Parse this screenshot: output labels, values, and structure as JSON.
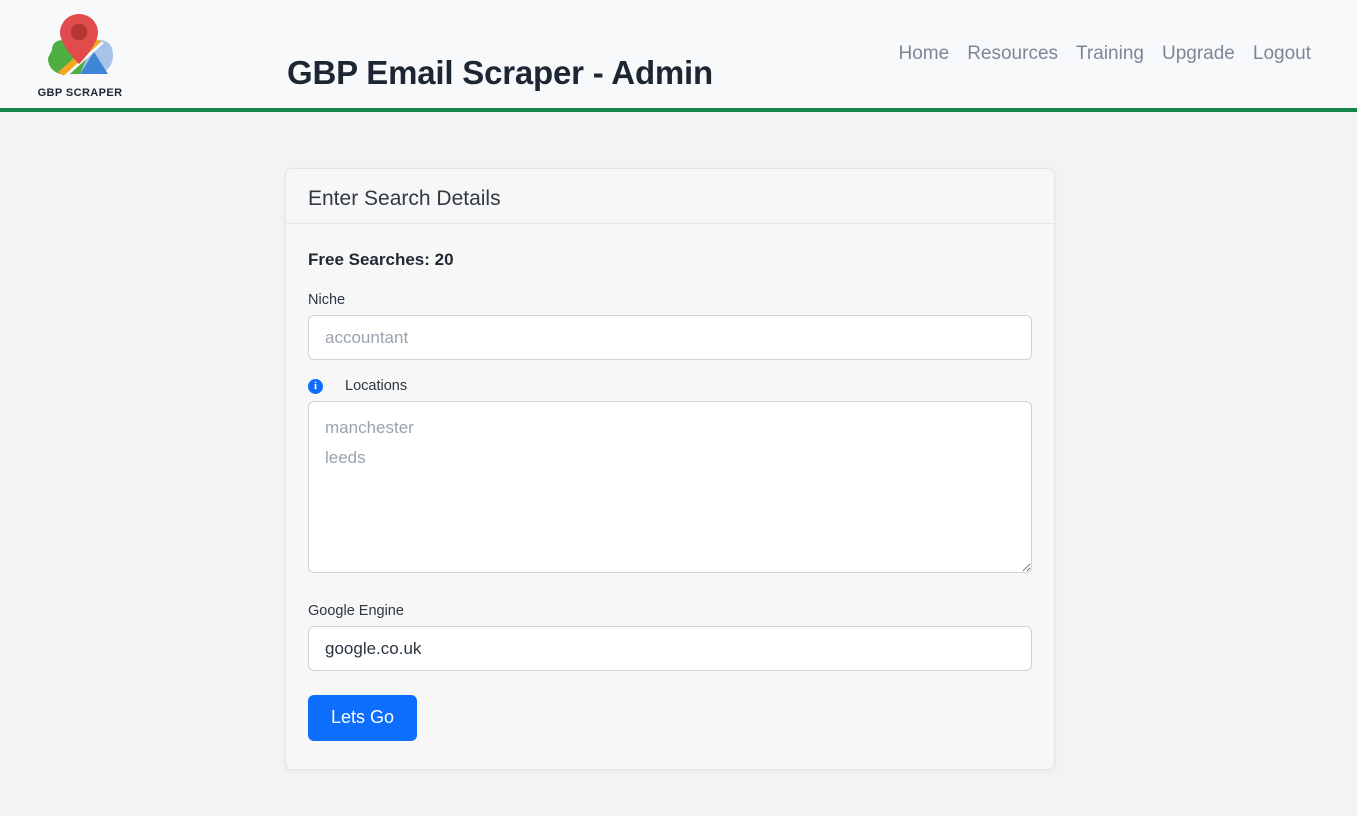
{
  "header": {
    "title": "GBP Email Scraper - Admin",
    "logo": {
      "name": "gbp-scraper-logo",
      "caption": "GBP SCRAPER",
      "colors": {
        "pin": "#e24b4b",
        "pin_center": "#b53434",
        "map_green": "#4caf3f",
        "map_orange": "#f5a623",
        "map_blue": "#3f86d6",
        "map_lightblue": "#a7c4e6"
      }
    },
    "nav": [
      {
        "label": "Home"
      },
      {
        "label": "Resources"
      },
      {
        "label": "Training"
      },
      {
        "label": "Upgrade"
      },
      {
        "label": "Logout"
      }
    ],
    "accent_bar_color": "#16854c",
    "background_color": "#f8f9fa"
  },
  "card": {
    "title": "Enter Search Details",
    "free_searches_label": "Free Searches: 20",
    "fields": {
      "niche": {
        "label": "Niche",
        "value": "",
        "placeholder": "accountant"
      },
      "locations": {
        "label": "Locations",
        "info_icon": "info-icon",
        "info_glyph": "i",
        "value": "",
        "placeholder": "manchester\nleeds"
      },
      "google_engine": {
        "label": "Google Engine",
        "value": "google.co.uk",
        "placeholder": ""
      }
    },
    "submit_label": "Lets Go",
    "submit_color": "#0d6efd"
  },
  "page": {
    "background_color": "#f3f3f4"
  }
}
